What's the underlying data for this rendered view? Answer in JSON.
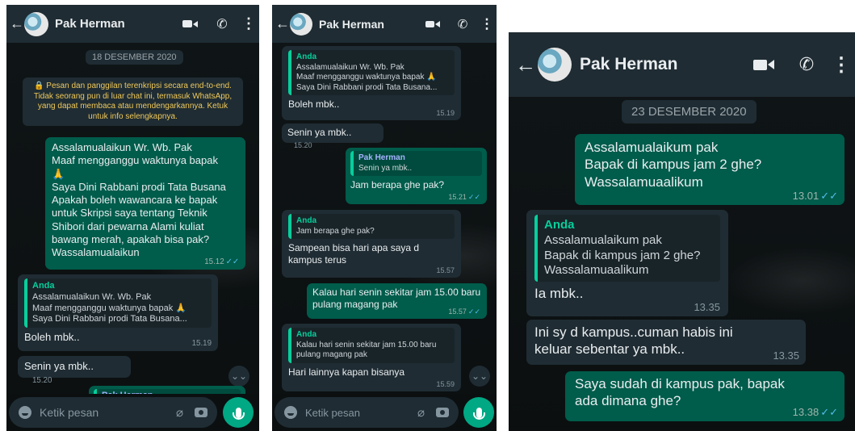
{
  "contact": {
    "name": "Pak Herman"
  },
  "panel1": {
    "date": "18 DESEMBER 2020",
    "encryption": "🔒 Pesan dan panggilan terenkripsi secara end-to-end. Tidak seorang pun di luar chat ini, termasuk WhatsApp, yang dapat membaca atau mendengarkannya. Ketuk untuk info selengkapnya.",
    "m1": {
      "text": "Assalamualaikun Wr. Wb. Pak\nMaaf mengganggu waktunya bapak\n🙏\nSaya Dini Rabbani prodi Tata Busana\nApakah boleh wawancara ke bapak untuk Skripsi saya tentang Teknik Shibori dari pewarna Alami kuliat bawang merah, apakah bisa pak?\nWassalamualaikun",
      "time": "15.12"
    },
    "m2": {
      "quote_name": "Anda",
      "quote_text": "Assalamualaikun Wr. Wb. Pak\nMaaf mengganggu waktunya bapak 🙏\nSaya Dini Rabbani prodi Tata Busana...",
      "text": "Boleh mbk..",
      "time": "15.19"
    },
    "m3": {
      "text": "Senin ya mbk..",
      "time": "15.20"
    },
    "m4": {
      "quote_name": "Pak Herman"
    },
    "input_placeholder": "Ketik pesan"
  },
  "panel2": {
    "m1": {
      "quote_name": "Anda",
      "quote_text": "Assalamualaikun Wr. Wb. Pak\nMaaf mengganggu waktunya bapak 🙏\nSaya Dini Rabbani prodi Tata Busana...",
      "text": "Boleh mbk..",
      "time": "15.19"
    },
    "m2": {
      "text": "Senin ya mbk..",
      "time": "15.20"
    },
    "m3": {
      "quote_name": "Pak Herman",
      "quote_text": "Senin ya mbk..",
      "text": "Jam berapa ghe pak?",
      "time": "15.21"
    },
    "m4": {
      "quote_name": "Anda",
      "quote_text": "Jam berapa ghe pak?",
      "text": "Sampean bisa hari apa saya d kampus terus",
      "time": "15.57"
    },
    "m5": {
      "text": "Kalau hari senin sekitar jam 15.00 baru pulang magang pak",
      "time": "15.57"
    },
    "m6": {
      "quote_name": "Anda",
      "quote_text": "Kalau hari senin sekitar jam 15.00 baru pulang magang pak",
      "text": "Hari lainnya kapan bisanya",
      "time": "15.59"
    },
    "input_placeholder": "Ketik pesan"
  },
  "panel3": {
    "date": "23 DESEMBER 2020",
    "m1": {
      "text": "Assalamualaikum pak\nBapak di kampus jam 2 ghe?\nWassalamuaalikum",
      "time": "13.01"
    },
    "m2": {
      "quote_name": "Anda",
      "quote_text": "Assalamualaikum pak\nBapak di kampus jam 2 ghe?\nWassalamuaalikum",
      "text": "Ia mbk..",
      "time": "13.35"
    },
    "m3": {
      "text": "Ini sy d kampus..cuman habis ini keluar sebentar ya mbk..",
      "time": "13.35"
    },
    "m4": {
      "text": "Saya sudah di kampus pak, bapak ada dimana ghe?",
      "time": "13.38"
    }
  },
  "icons": [
    "back-arrow-icon",
    "video-call-icon",
    "phone-icon",
    "more-vert-icon",
    "emoji-icon",
    "attach-icon",
    "camera-icon",
    "mic-icon",
    "chevron-down-icon",
    "double-check-icon",
    "lock-icon"
  ],
  "colors": {
    "header": "#1f2c33",
    "outgoing": "#005c4b",
    "incoming": "#1f2c33",
    "accent": "#00a884",
    "read_tick": "#53bdeb",
    "encryption_text": "#f0c95a"
  }
}
